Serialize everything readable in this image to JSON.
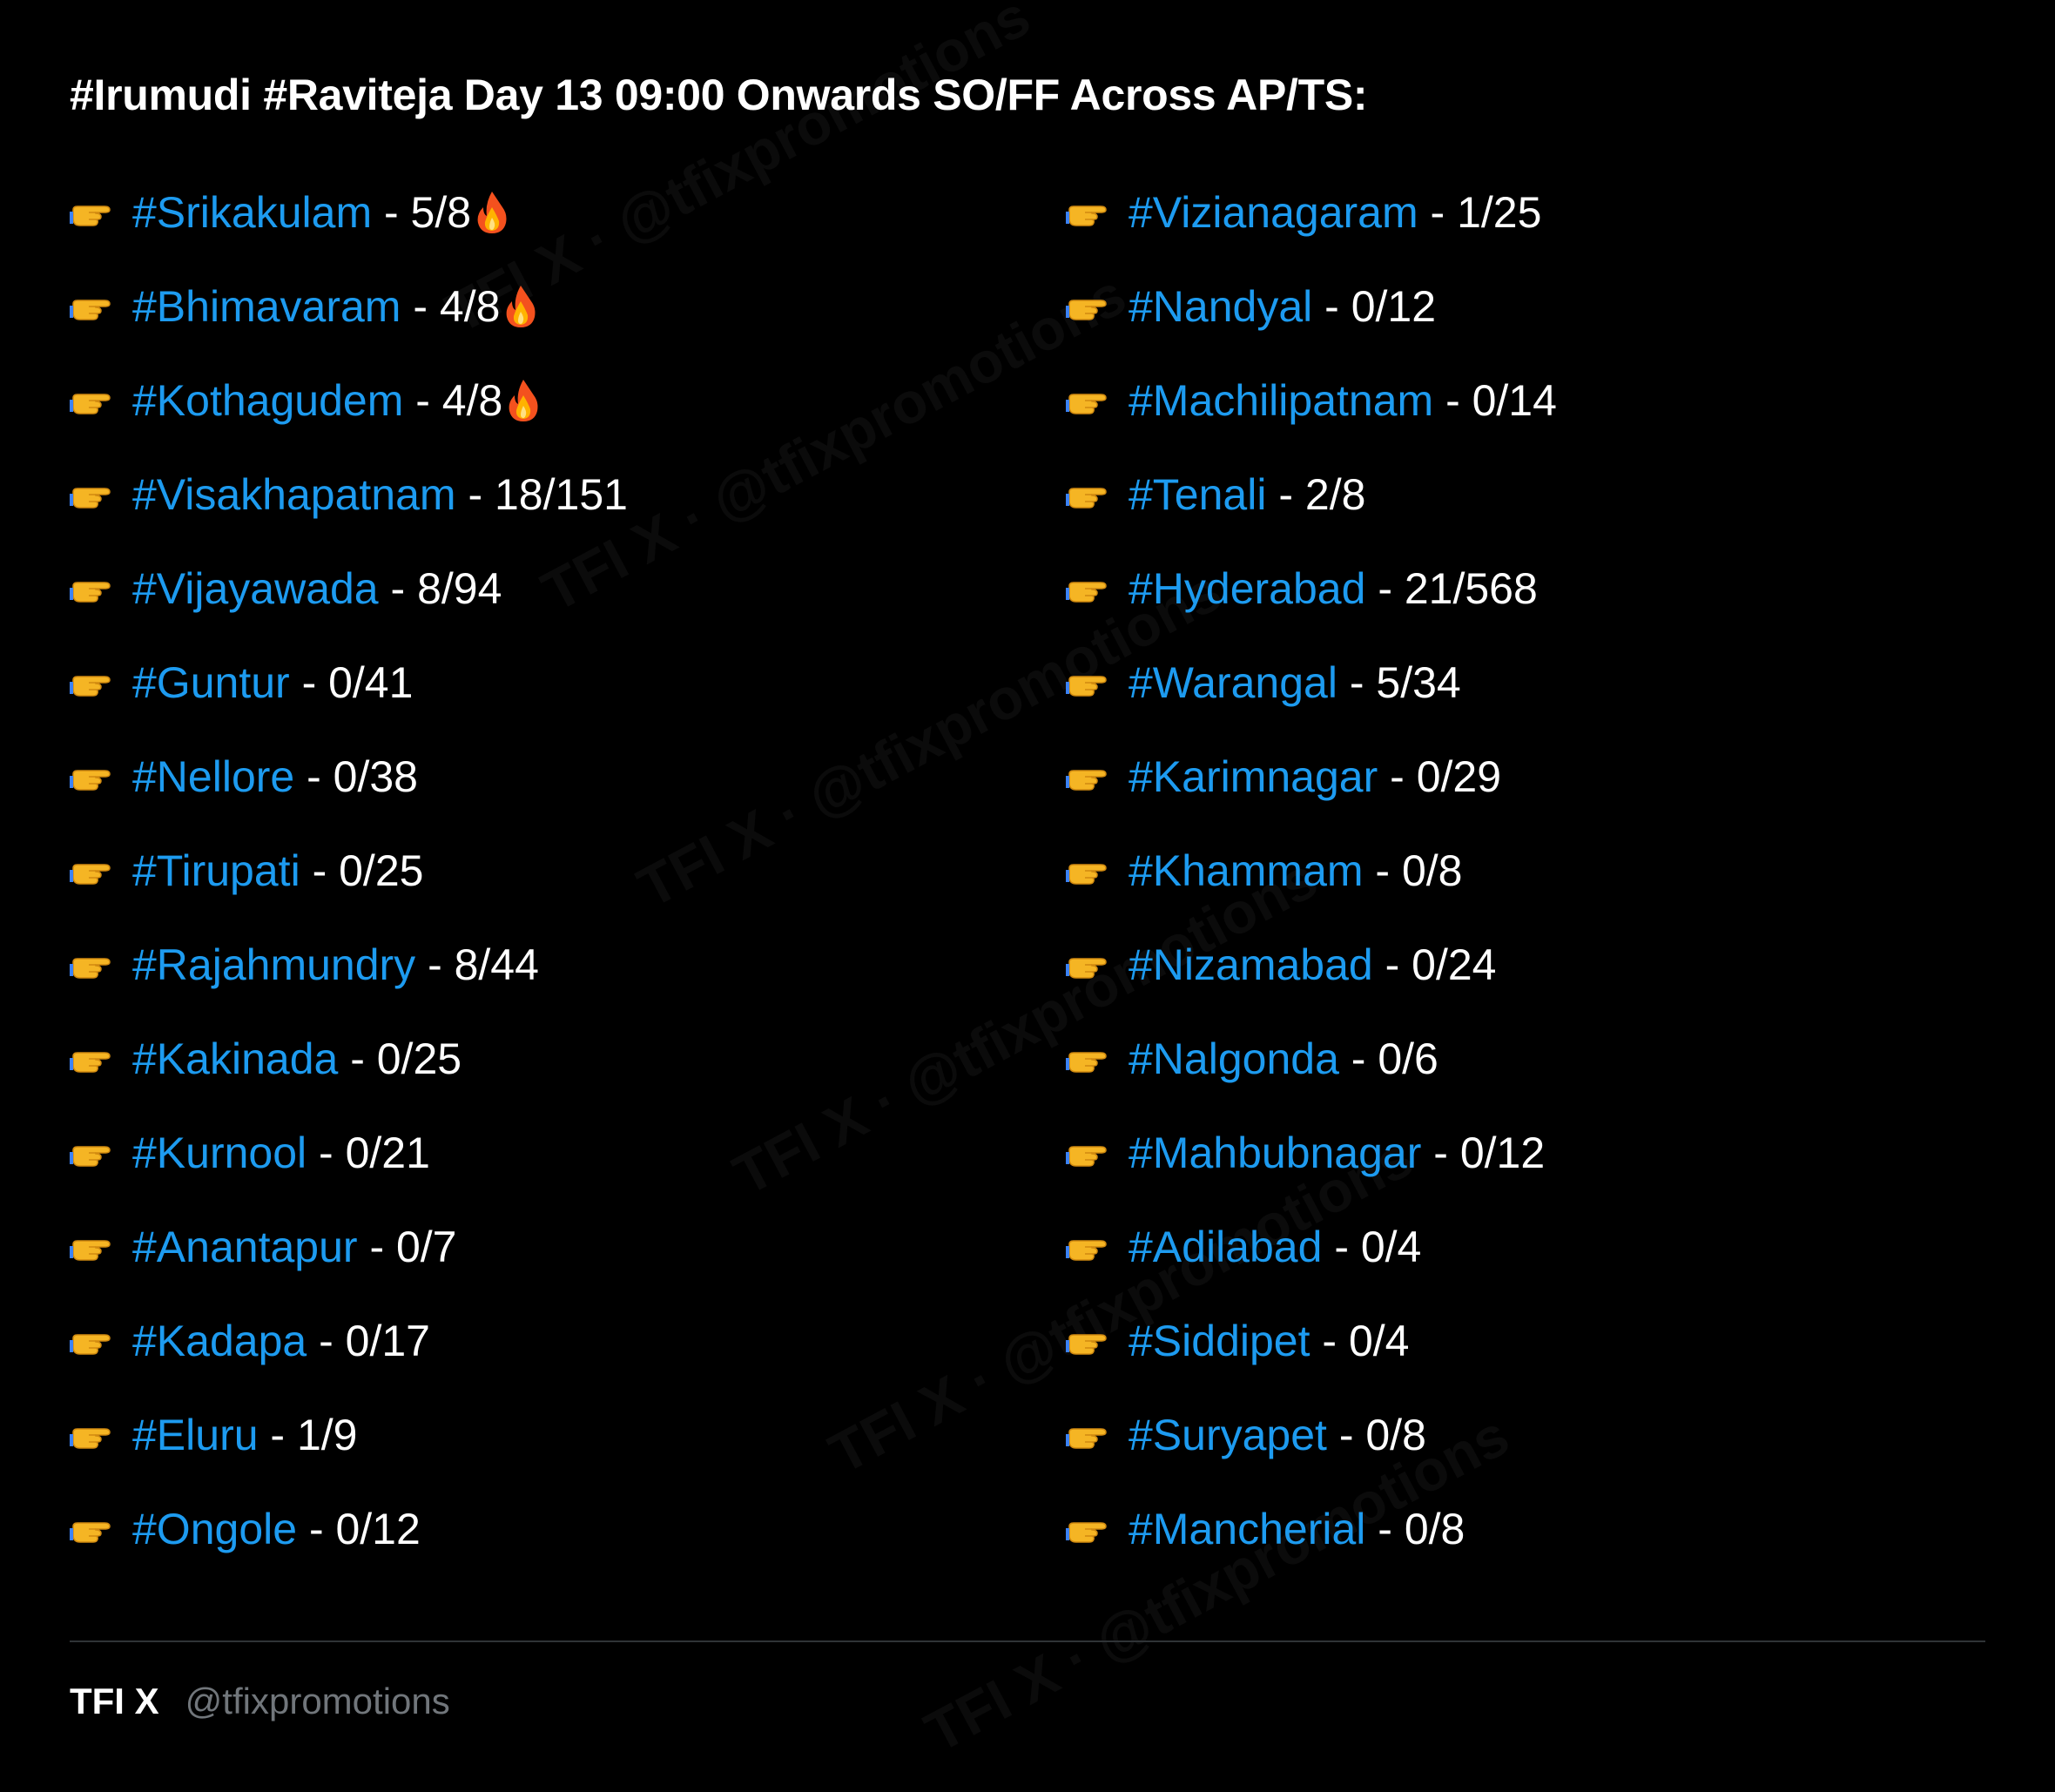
{
  "title": "#Irumudi #Raviteja Day 13 09:00 Onwards SO/FF Across AP/TS:",
  "separator": " - ",
  "icons": {
    "bullet": "backhand-index-pointing-right-icon",
    "hot": "fire-icon"
  },
  "colors": {
    "background": "#000000",
    "hashtag": "#1d9bf0",
    "text": "#ffffff",
    "muted": "#71767b"
  },
  "left_column": [
    {
      "tag": "#Srikakulam",
      "value": "5/8",
      "fire": true
    },
    {
      "tag": "#Bhimavaram",
      "value": "4/8",
      "fire": true
    },
    {
      "tag": "#Kothagudem",
      "value": "4/8",
      "fire": true
    },
    {
      "tag": "#Visakhapatnam",
      "value": "18/151",
      "fire": false
    },
    {
      "tag": "#Vijayawada",
      "value": "8/94",
      "fire": false
    },
    {
      "tag": "#Guntur",
      "value": "0/41",
      "fire": false
    },
    {
      "tag": "#Nellore",
      "value": "0/38",
      "fire": false
    },
    {
      "tag": "#Tirupati",
      "value": "0/25",
      "fire": false
    },
    {
      "tag": "#Rajahmundry",
      "value": "8/44",
      "fire": false
    },
    {
      "tag": "#Kakinada",
      "value": "0/25",
      "fire": false
    },
    {
      "tag": "#Kurnool",
      "value": "0/21",
      "fire": false
    },
    {
      "tag": "#Anantapur",
      "value": "0/7",
      "fire": false
    },
    {
      "tag": "#Kadapa",
      "value": "0/17",
      "fire": false
    },
    {
      "tag": "#Eluru",
      "value": "1/9",
      "fire": false
    },
    {
      "tag": "#Ongole",
      "value": "0/12",
      "fire": false
    }
  ],
  "right_column": [
    {
      "tag": "#Vizianagaram",
      "value": "1/25",
      "fire": false
    },
    {
      "tag": "#Nandyal",
      "value": "0/12",
      "fire": false
    },
    {
      "tag": "#Machilipatnam",
      "value": "0/14",
      "fire": false
    },
    {
      "tag": "#Tenali",
      "value": "2/8",
      "fire": false
    },
    {
      "tag": "#Hyderabad",
      "value": "21/568",
      "fire": false
    },
    {
      "tag": "#Warangal",
      "value": "5/34",
      "fire": false
    },
    {
      "tag": "#Karimnagar",
      "value": "0/29",
      "fire": false
    },
    {
      "tag": "#Khammam",
      "value": "0/8",
      "fire": false
    },
    {
      "tag": "#Nizamabad",
      "value": "0/24",
      "fire": false
    },
    {
      "tag": "#Nalgonda",
      "value": "0/6",
      "fire": false
    },
    {
      "tag": "#Mahbubnagar",
      "value": "0/12",
      "fire": false
    },
    {
      "tag": "#Adilabad",
      "value": "0/4",
      "fire": false
    },
    {
      "tag": "#Siddipet",
      "value": "0/4",
      "fire": false
    },
    {
      "tag": "#Suryapet",
      "value": "0/8",
      "fire": false
    },
    {
      "tag": "#Mancherial",
      "value": "0/8",
      "fire": false
    }
  ],
  "footer": {
    "brand": "TFI X",
    "handle": "@tfixpromotions"
  },
  "watermark": "TFI X · @tfixpromotions"
}
